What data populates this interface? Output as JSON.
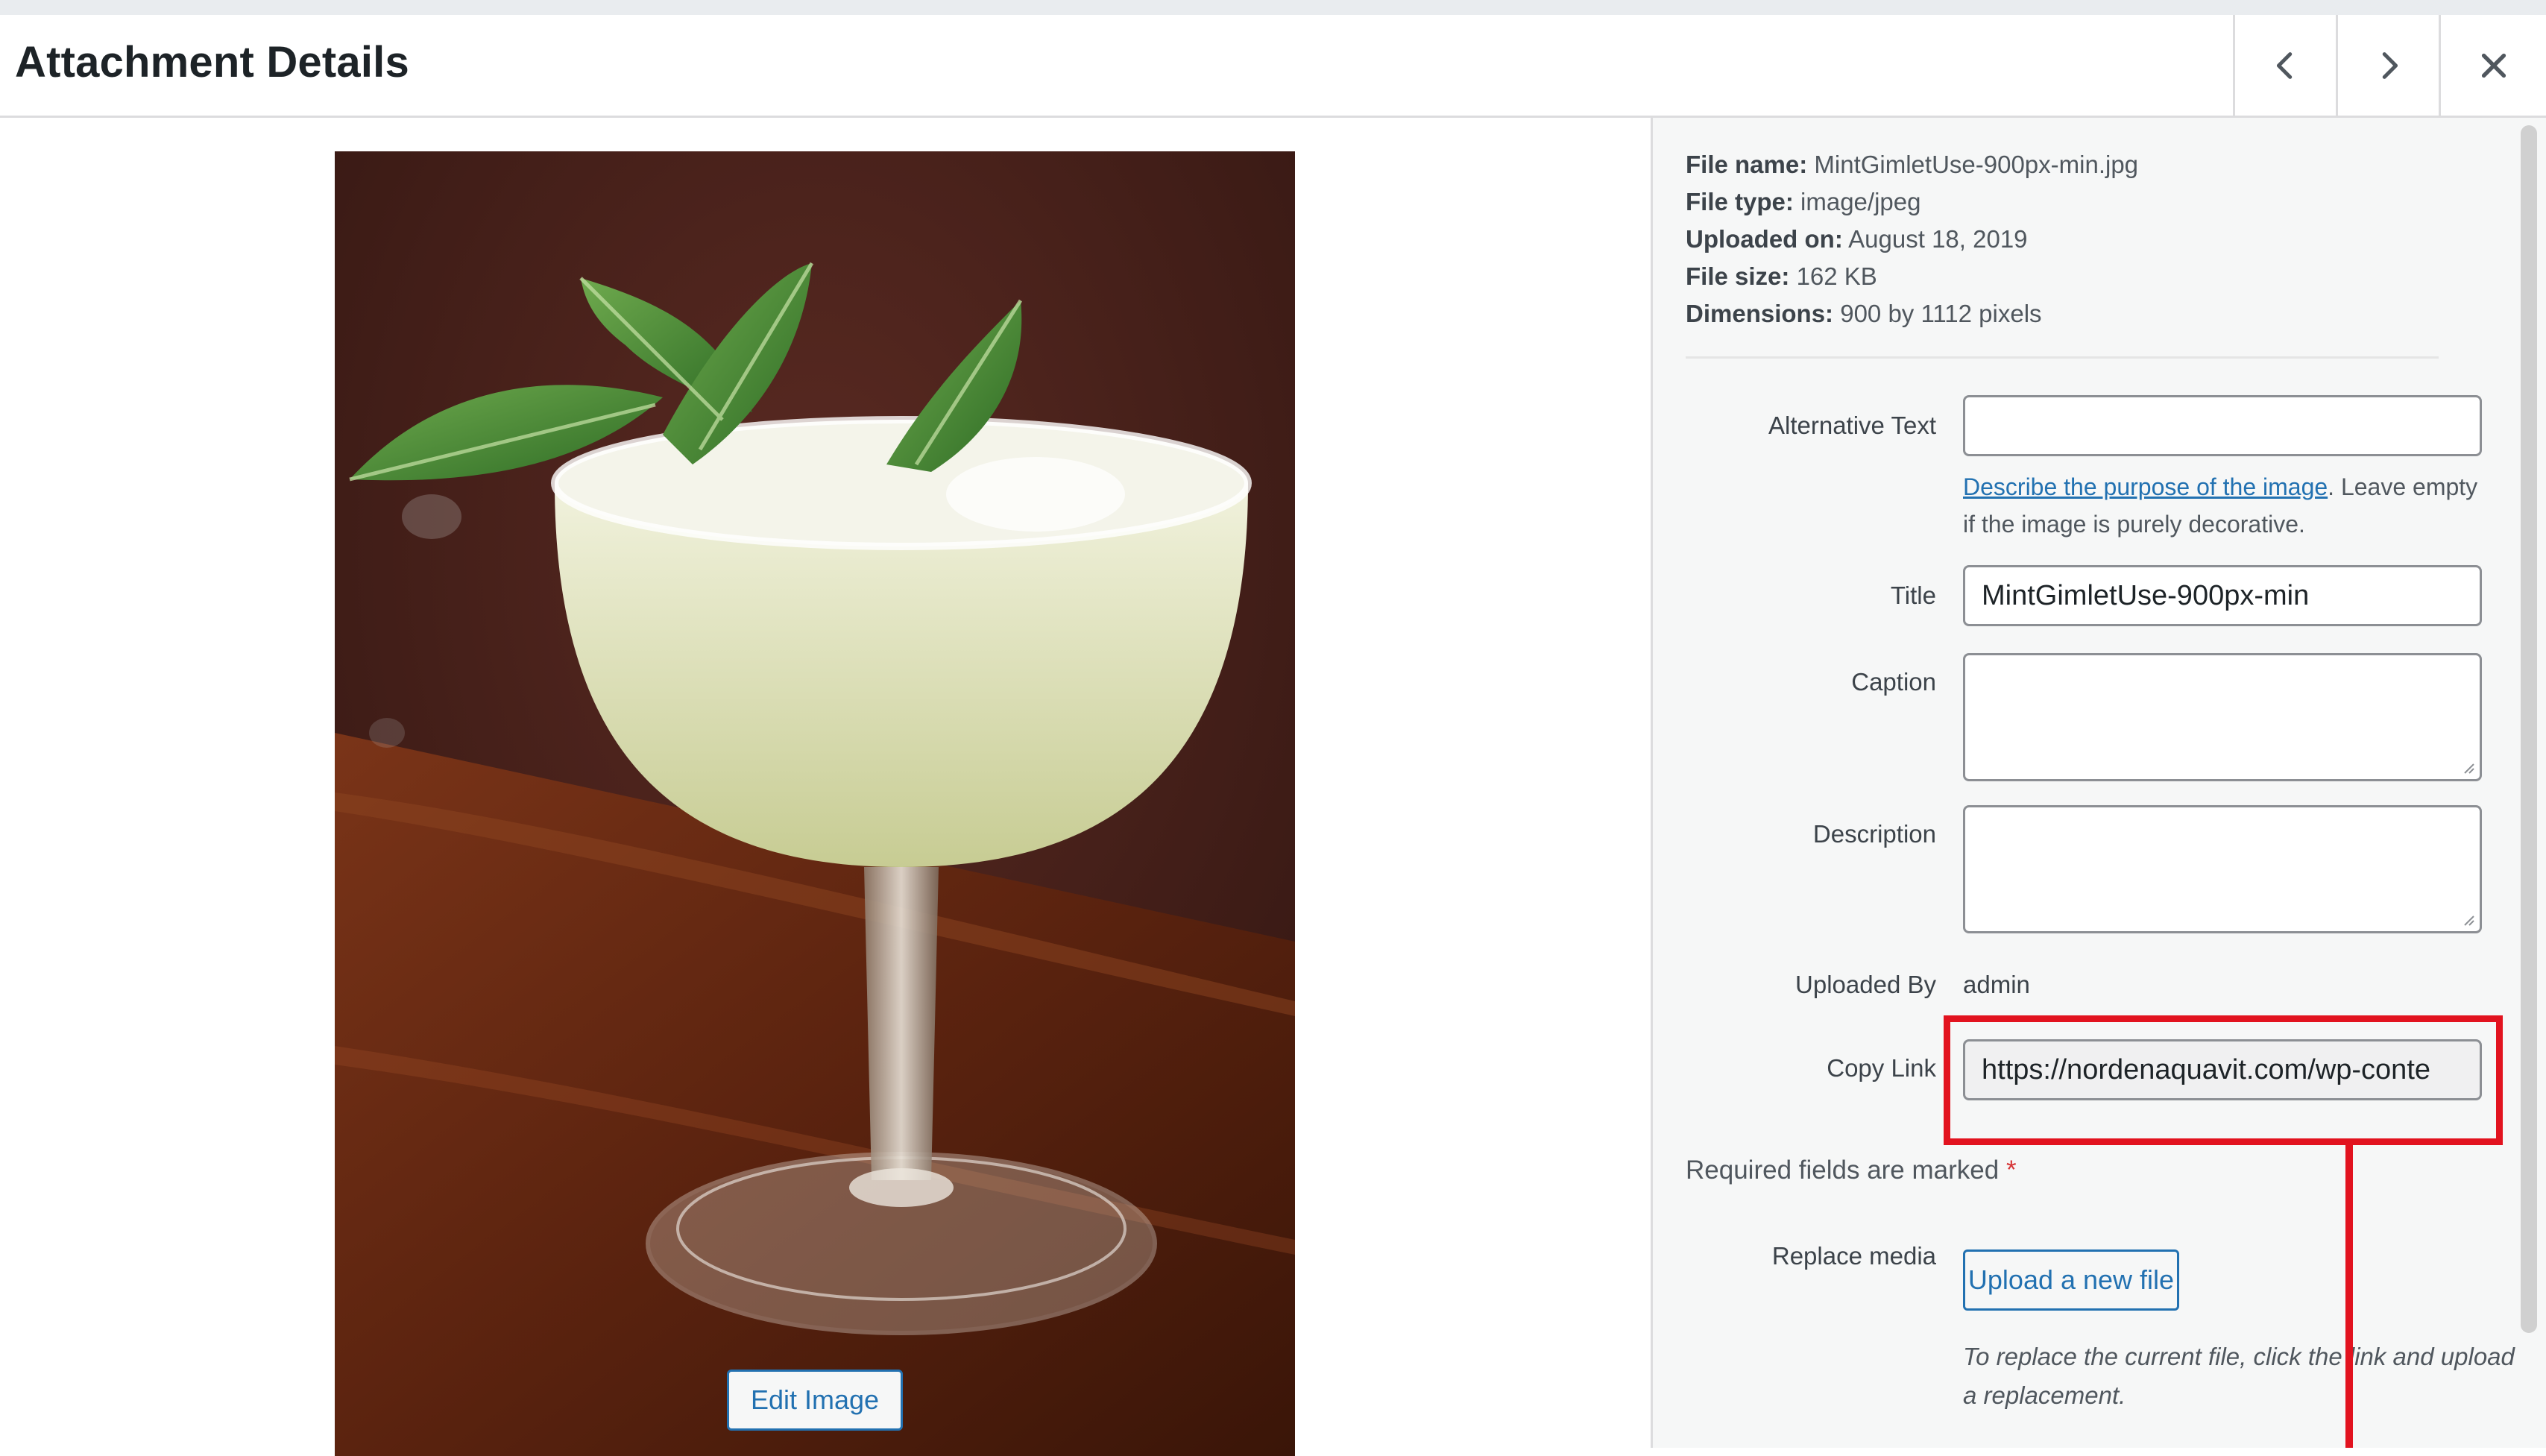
{
  "header": {
    "title": "Attachment Details",
    "prev_icon": "chevron-left-icon",
    "next_icon": "chevron-right-icon",
    "close_icon": "close-icon"
  },
  "preview": {
    "image_subject": "mint gimlet cocktail in coupe glass",
    "edit_button": "Edit Image"
  },
  "meta": {
    "file_name_label": "File name:",
    "file_name": "MintGimletUse-900px-min.jpg",
    "file_type_label": "File type:",
    "file_type": "image/jpeg",
    "uploaded_on_label": "Uploaded on:",
    "uploaded_on": "August 18, 2019",
    "file_size_label": "File size:",
    "file_size": "162 KB",
    "dimensions_label": "Dimensions:",
    "dimensions": "900 by 1112 pixels"
  },
  "form": {
    "alt_text_label": "Alternative Text",
    "alt_text_value": "",
    "alt_help_link": "Describe the purpose of the image",
    "alt_help_rest": ". Leave empty if the image is purely decorative.",
    "title_label": "Title",
    "title_value": "MintGimletUse-900px-min",
    "caption_label": "Caption",
    "caption_value": "",
    "description_label": "Description",
    "description_value": "",
    "uploaded_by_label": "Uploaded By",
    "uploaded_by_value": "admin",
    "copy_link_label": "Copy Link",
    "copy_link_value": "https://nordenaquavit.com/wp-conte",
    "required_text": "Required fields are marked",
    "required_star": "*",
    "replace_label": "Replace media",
    "upload_button": "Upload a new file",
    "replace_note": "To replace the current file, click the link and upload a replacement."
  },
  "colors": {
    "accent": "#2271b1",
    "highlight": "#e2131f",
    "sidebar_bg": "#f6f7f7"
  }
}
